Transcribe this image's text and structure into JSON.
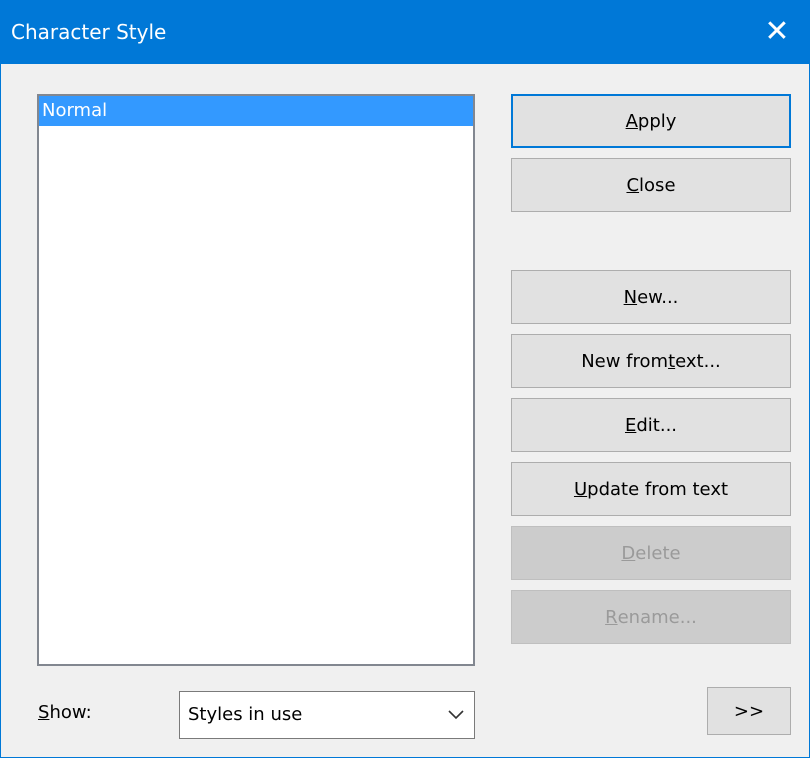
{
  "window": {
    "title": "Character Style",
    "close_glyph": "✕"
  },
  "styles_list": {
    "items": [
      {
        "label": "Normal",
        "selected": true
      }
    ]
  },
  "buttons": {
    "apply": {
      "pre": "",
      "key": "A",
      "post": "pply"
    },
    "close": {
      "pre": "",
      "key": "C",
      "post": "lose"
    },
    "new": {
      "pre": "",
      "key": "N",
      "post": "ew..."
    },
    "new_from_text": {
      "pre": "New from ",
      "key": "t",
      "post": "ext..."
    },
    "edit": {
      "pre": "",
      "key": "E",
      "post": "dit..."
    },
    "update": {
      "pre": "",
      "key": "U",
      "post": "pdate from text"
    },
    "delete": {
      "pre": "",
      "key": "D",
      "post": "elete",
      "disabled": true
    },
    "rename": {
      "pre": "",
      "key": "R",
      "post": "ename...",
      "disabled": true
    }
  },
  "show": {
    "label_key": "S",
    "label_rest": "how:",
    "selected_value": "Styles in use",
    "icon": "chevron-down-icon"
  },
  "more_button": {
    "label": ">>"
  },
  "colors": {
    "titlebar": "#0078d7",
    "selection": "#3399ff",
    "dialog_bg": "#f0f0f0"
  }
}
